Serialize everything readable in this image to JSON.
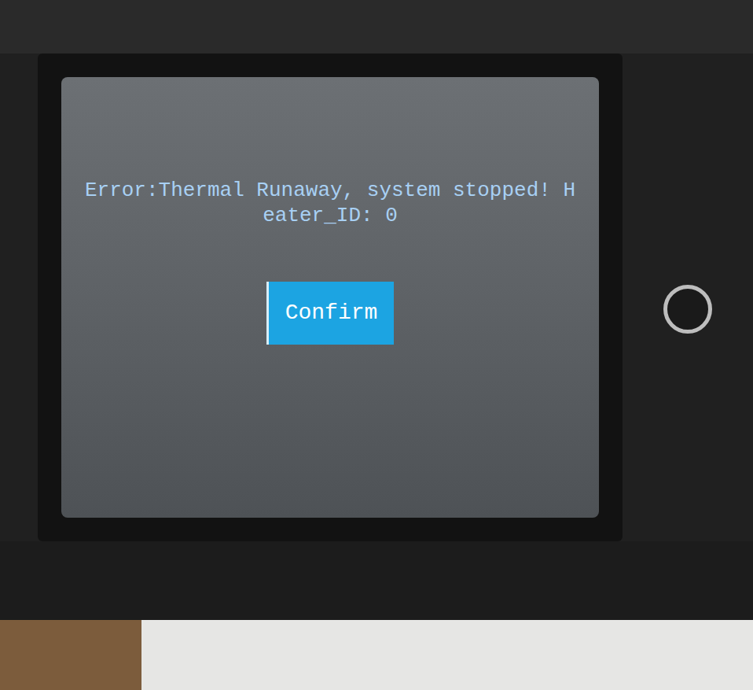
{
  "dialog": {
    "message": "Error:Thermal Runaway, system stopped! Heater_ID: 0",
    "button": "Confirm"
  }
}
